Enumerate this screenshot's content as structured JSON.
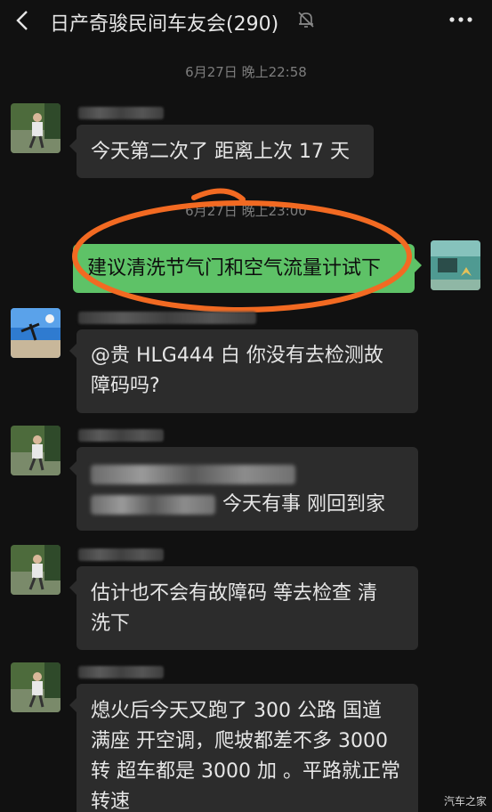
{
  "header": {
    "title": "日产奇骏民间车友会(290)",
    "back_icon": "chevron-left-icon",
    "mute_icon": "bell-off-icon",
    "more_icon": "ellipsis-icon"
  },
  "timestamps": [
    "6月27日 晚上22:58",
    "6月27日 晚上23:00"
  ],
  "messages": [
    {
      "lines": [
        "今天第二次了 距离上次 17 天"
      ]
    },
    {
      "lines": [
        "建议清洗节气门和空气流量计试下"
      ]
    },
    {
      "lines": [
        "@贵 HLG444 白  你没有去检测故",
        "障码吗?"
      ]
    },
    {
      "lines": [
        "",
        "今天有事 刚回到家"
      ]
    },
    {
      "lines": [
        "估计也不会有故障码 等去检查 清",
        "洗下"
      ]
    },
    {
      "lines": [
        "熄火后今天又跑了 300 公路 国道",
        "满座 开空调，爬坡都差不多 3000",
        "转 超车都是 3000 加 。平路就正常",
        "转速"
      ]
    }
  ],
  "watermark": "汽车之家",
  "colors": {
    "background": "#111111",
    "bubble": "#2c2c2c",
    "bubble_mine": "#5ec267",
    "highlight_circle": "#f26a22"
  }
}
